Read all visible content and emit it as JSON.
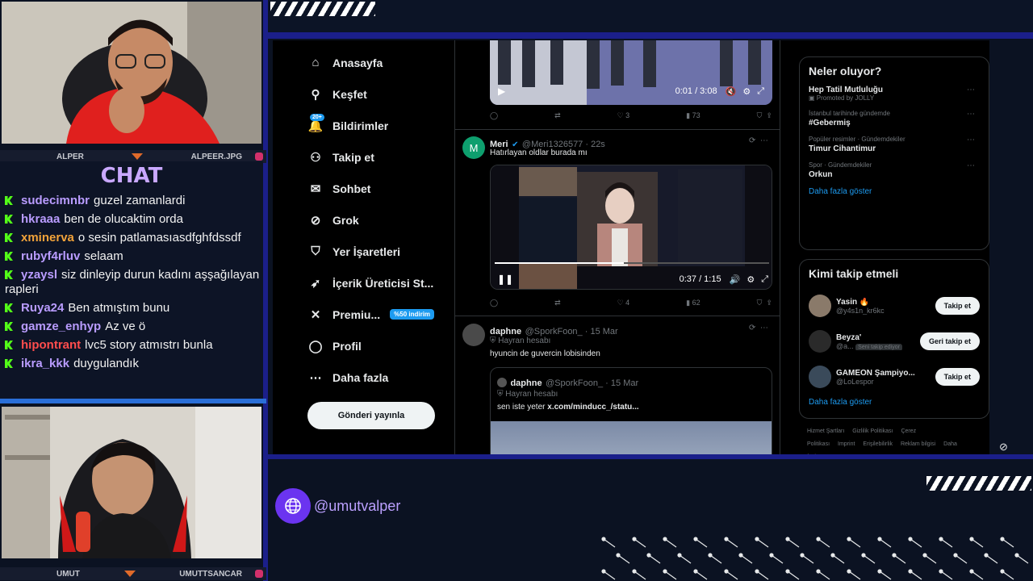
{
  "cams": {
    "top": {
      "left": "ALPER",
      "right": "ALPEER.JPG"
    },
    "bottom": {
      "left": "UMUT",
      "right": "UMUTTSANCAR"
    }
  },
  "chat": {
    "title": "CHAT",
    "messages": [
      {
        "user": "sudecimnbr",
        "color": "#b99cff",
        "text": "guzel zamanlardi"
      },
      {
        "user": "hkraaa",
        "color": "#b99cff",
        "text": "ben de olucaktim orda"
      },
      {
        "user": "xminerva",
        "color": "#f2a33a",
        "text": "o sesin patlamasıasdfghfdssdf"
      },
      {
        "user": "rubyf4rluv",
        "color": "#b99cff",
        "text": "selaam"
      },
      {
        "user": "yzaysl",
        "color": "#b99cff",
        "text": "siz dinleyip durun kadını aşşağılayan rapleri"
      },
      {
        "user": "Ruya24",
        "color": "#b99cff",
        "text": "Ben atmıştım bunu"
      },
      {
        "user": "gamze_enhyp",
        "color": "#b99cff",
        "text": "Az ve ö"
      },
      {
        "user": "hipontrant",
        "color": "#ff4d4d",
        "text": "lvc5 story atmıstrı bunla"
      },
      {
        "user": "ikra_kkk",
        "color": "#b99cff",
        "text": "duygulandık"
      }
    ]
  },
  "nav": {
    "items": [
      {
        "label": "Anasayfa",
        "icon": "home-icon",
        "glyph": "⌂"
      },
      {
        "label": "Keşfet",
        "icon": "search-icon",
        "glyph": "⚲"
      },
      {
        "label": "Bildirimler",
        "icon": "bell-icon",
        "glyph": "🔔",
        "badge": "20+"
      },
      {
        "label": "Takip et",
        "icon": "person-add-icon",
        "glyph": "⚇"
      },
      {
        "label": "Sohbet",
        "icon": "mail-icon",
        "glyph": "✉"
      },
      {
        "label": "Grok",
        "icon": "grok-icon",
        "glyph": "⊘"
      },
      {
        "label": "Yer İşaretleri",
        "icon": "bookmark-icon",
        "glyph": "⛉"
      },
      {
        "label": "İçerik Üreticisi St...",
        "icon": "rocket-icon",
        "glyph": "➶"
      },
      {
        "label": "Premiu...",
        "icon": "x-logo-icon",
        "glyph": "✕",
        "tag": "%50 indirim"
      },
      {
        "label": "Profil",
        "icon": "profile-icon",
        "glyph": "◯"
      },
      {
        "label": "Daha fazla",
        "icon": "more-icon",
        "glyph": "⋯"
      }
    ],
    "post_button": "Gönderi yayınla"
  },
  "feed": {
    "video1": {
      "time": "0:01 / 3:08",
      "replies": "",
      "likes": "3",
      "views": "73"
    },
    "tweet2": {
      "name": "Meri",
      "handle": "@Meri1326577 · 22s",
      "text": "Hatırlayan oldlar burada mı",
      "video_time": "0:37 / 1:15",
      "likes": "4",
      "views": "62"
    },
    "tweet3": {
      "name": "daphne",
      "handle": "@SporkFoon_ · 15 Mar",
      "badge": "Hayran hesabı",
      "text": "hyuncin de guvercin lobisinden",
      "quote": {
        "name": "daphne",
        "handle": "@SporkFoon_ · 15 Mar",
        "badge": "Hayran hesabı",
        "text_plain": "sen iste yeter",
        "link": "x.com/minducc_/statu..."
      }
    }
  },
  "trends": {
    "title": "Neler oluyor?",
    "items": [
      {
        "meta": "Promoted by JOLLY",
        "title": "Hep Tatil Mutluluğu",
        "promoted": true
      },
      {
        "meta": "İstanbul tarihinde gündemde",
        "title": "#Gebermiş"
      },
      {
        "meta": "Popüler resimler · Gündemdekiler",
        "title": "Timur Cihantimur"
      },
      {
        "meta": "Spor · Gündemdekiler",
        "title": "Orkun"
      }
    ],
    "show_more": "Daha fazla göster"
  },
  "who_to_follow": {
    "title": "Kimi takip etmeli",
    "items": [
      {
        "name": "Yasin 🔥",
        "handle": "@y4s1n_kr6kc",
        "button": "Takip et"
      },
      {
        "name": "Beyza'",
        "handle": "@a...",
        "follows_you": "Seni takip ediyor",
        "button": "Geri takip et"
      },
      {
        "name": "GAMEON Şampiyo...",
        "handle": "@LoLespor",
        "button": "Takip et"
      }
    ],
    "show_more": "Daha fazla göster"
  },
  "footer": {
    "links": [
      "Hizmet Şartları",
      "Gizlilik Politikası",
      "Çerez Politikası",
      "Imprint",
      "Erişilebilirlik",
      "Reklam bilgisi",
      "Daha fazla ..."
    ]
  },
  "handle": "@umutvalper"
}
